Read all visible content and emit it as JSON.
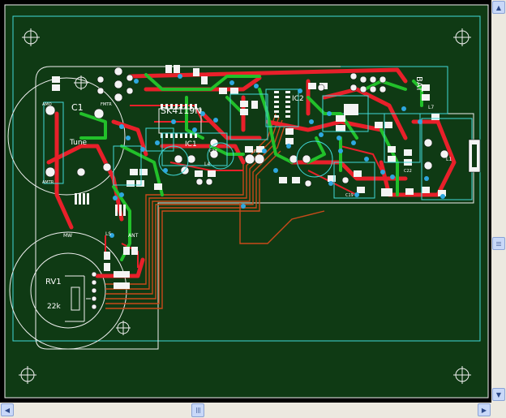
{
  "colors": {
    "board": "#0f3a14",
    "outline": "#f0f0f0",
    "top_copper": "#e8202a",
    "bottom_copper": "#22c02a",
    "silkscreen": "#ffffff",
    "via": "#2ea8e0",
    "keepout": "#40d8d8",
    "background": "#000000",
    "bus_traces": "#c84a1a"
  },
  "labels": {
    "ic_main": "SK4119N",
    "ic1": "IC1",
    "ic2": "IC2",
    "c1": "C1",
    "tune": "Tune",
    "amo": "AMO",
    "fmtr": "FMTR",
    "amtr": "AMTR",
    "mw": "MW",
    "ant": "ANT",
    "ls": "LS",
    "rv1": "RV1",
    "rv1_value": "22k",
    "bat": "BAT",
    "l4": "L4",
    "l7": "L7",
    "l1": "L1",
    "c22": "C22",
    "c17": "C17",
    "c32": "C32",
    "c20": "C20",
    "c19": "C19"
  },
  "icons": {
    "scroll_up": "arrow-up-icon",
    "scroll_down": "arrow-down-icon",
    "scroll_left": "arrow-left-icon",
    "scroll_right": "arrow-right-icon",
    "mounting_hole": "crosshair-icon"
  },
  "scroll": {
    "up_glyph": "▲",
    "down_glyph": "▼",
    "left_glyph": "◀",
    "right_glyph": "▶"
  }
}
